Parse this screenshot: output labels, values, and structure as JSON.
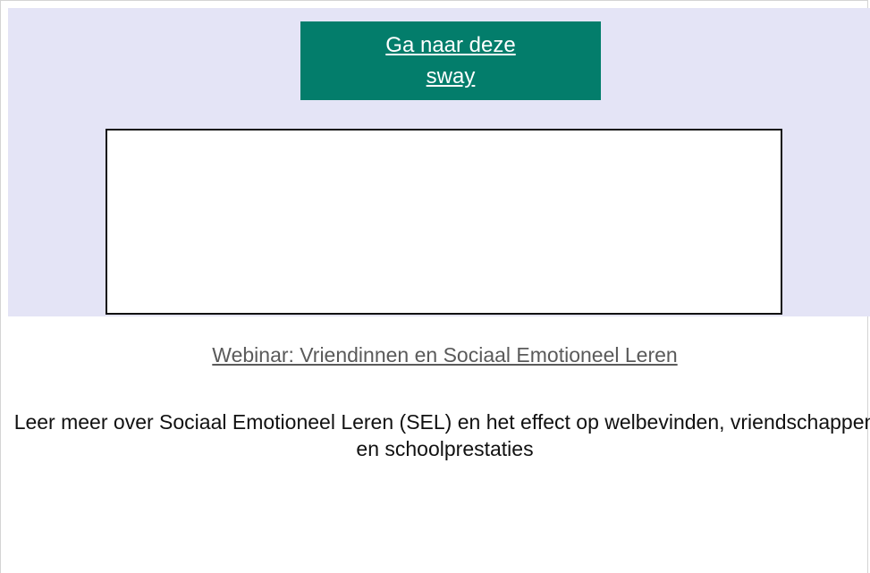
{
  "cta_button": {
    "label": "Ga naar deze sway",
    "background": "#037d6b"
  },
  "webinar": {
    "link_text": "Webinar: Vriendinnen en Sociaal Emotioneel Leren"
  },
  "description": {
    "text": "Leer meer over Sociaal Emotioneel Leren (SEL) en het effect op welbevinden, vriendschappen en schoolprestaties"
  },
  "colors": {
    "section_background": "#e4e4f6",
    "link_gray": "#5a5a5a"
  }
}
